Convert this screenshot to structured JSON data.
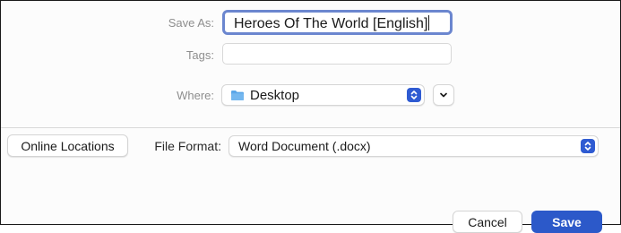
{
  "save_as": {
    "label": "Save As:",
    "value": "Heroes Of The World [English]"
  },
  "tags": {
    "label": "Tags:",
    "value": ""
  },
  "where": {
    "label": "Where:",
    "value": "Desktop"
  },
  "online_locations": {
    "label": "Online Locations"
  },
  "file_format": {
    "label": "File Format:",
    "value": "Word Document (.docx)"
  },
  "buttons": {
    "cancel": "Cancel",
    "save": "Save"
  },
  "colors": {
    "accent": "#2c59c9",
    "focus_ring": "#6b86cf",
    "folder": "#5aa6e8"
  }
}
